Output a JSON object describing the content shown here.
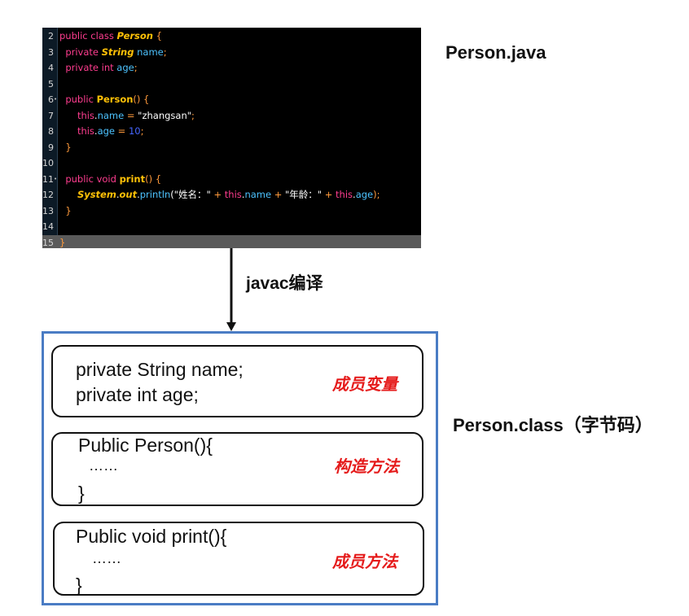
{
  "file_label": "Person.java",
  "class_label": "Person.class（字节码）",
  "arrow_label": "javac编译",
  "code_lines": [
    {
      "num": "2",
      "mark": "",
      "tokens": [
        [
          "kw",
          "public class "
        ],
        [
          "cls",
          "Person"
        ],
        [
          "br",
          " {"
        ]
      ]
    },
    {
      "num": "3",
      "mark": "",
      "tokens": [
        [
          "pl",
          "  "
        ],
        [
          "kw",
          "private "
        ],
        [
          "cls",
          "String"
        ],
        [
          "fld",
          " name"
        ],
        [
          "op",
          ";"
        ]
      ]
    },
    {
      "num": "4",
      "mark": "",
      "tokens": [
        [
          "pl",
          "  "
        ],
        [
          "kw",
          "private int "
        ],
        [
          "fld",
          "age"
        ],
        [
          "op",
          ";"
        ]
      ]
    },
    {
      "num": "5",
      "mark": "",
      "tokens": []
    },
    {
      "num": "6",
      "mark": "•",
      "tokens": [
        [
          "pl",
          "  "
        ],
        [
          "kw",
          "public "
        ],
        [
          "fn",
          "Person"
        ],
        [
          "br",
          "() {"
        ]
      ]
    },
    {
      "num": "7",
      "mark": "",
      "tokens": [
        [
          "pl",
          "      "
        ],
        [
          "kw",
          "this"
        ],
        [
          "pl",
          "."
        ],
        [
          "fld",
          "name"
        ],
        [
          "op",
          " = "
        ],
        [
          "str",
          "\"zhangsan\""
        ],
        [
          "op",
          ";"
        ]
      ]
    },
    {
      "num": "8",
      "mark": "",
      "tokens": [
        [
          "pl",
          "      "
        ],
        [
          "kw",
          "this"
        ],
        [
          "pl",
          "."
        ],
        [
          "fld",
          "age"
        ],
        [
          "op",
          " = "
        ],
        [
          "num",
          "10"
        ],
        [
          "op",
          ";"
        ]
      ]
    },
    {
      "num": "9",
      "mark": "",
      "tokens": [
        [
          "pl",
          "  "
        ],
        [
          "br",
          "}"
        ]
      ]
    },
    {
      "num": "10",
      "mark": "",
      "tokens": []
    },
    {
      "num": "11",
      "mark": "•",
      "tokens": [
        [
          "pl",
          "  "
        ],
        [
          "kw",
          "public void "
        ],
        [
          "fn",
          "print"
        ],
        [
          "br",
          "() {"
        ]
      ]
    },
    {
      "num": "12",
      "mark": "",
      "tokens": [
        [
          "pl",
          "      "
        ],
        [
          "cls",
          "System"
        ],
        [
          "pl",
          "."
        ],
        [
          "cls",
          "out"
        ],
        [
          "pl",
          "."
        ],
        [
          "fld",
          "println"
        ],
        [
          "pl",
          "(\"姓名：\" "
        ],
        [
          "op",
          "+ "
        ],
        [
          "kw",
          "this"
        ],
        [
          "pl",
          "."
        ],
        [
          "fld",
          "name"
        ],
        [
          "op",
          " + "
        ],
        [
          "pl",
          "\"年龄：\" "
        ],
        [
          "op",
          "+ "
        ],
        [
          "kw",
          "this"
        ],
        [
          "pl",
          "."
        ],
        [
          "fld",
          "age"
        ],
        [
          "op",
          ");"
        ]
      ]
    },
    {
      "num": "13",
      "mark": "",
      "tokens": [
        [
          "pl",
          "  "
        ],
        [
          "br",
          "}"
        ]
      ]
    },
    {
      "num": "14",
      "mark": "",
      "tokens": []
    },
    {
      "num": "15",
      "mark": "",
      "tokens": [
        [
          "br",
          "}"
        ]
      ],
      "highlight": true
    }
  ],
  "sections": {
    "fields": {
      "line1": "private String name;",
      "line2": "private int age;",
      "tag": "成员变量"
    },
    "constructor": {
      "line1": "Public Person(){",
      "line2": "……",
      "line3": "}",
      "tag": "构造方法"
    },
    "method": {
      "line1": "Public void print(){",
      "line2": "……",
      "line3": "}",
      "tag": "成员方法"
    }
  }
}
